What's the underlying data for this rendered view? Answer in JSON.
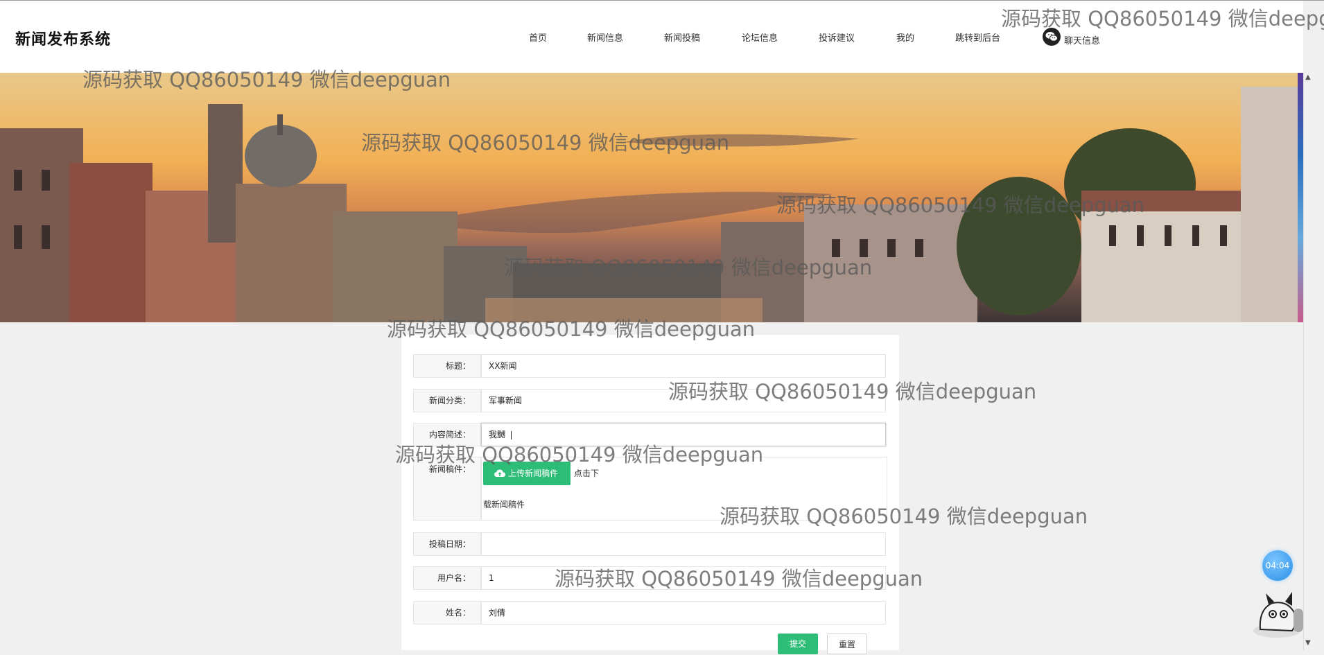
{
  "app": {
    "logo_text": "新闻发布系统"
  },
  "nav": {
    "items": [
      "首页",
      "新闻信息",
      "新闻投稿",
      "论坛信息",
      "投诉建议",
      "我的",
      "跳转到后台"
    ],
    "chat_label": "聊天信息"
  },
  "watermark_text": "源码获取 QQ86050149 微信deepguan",
  "form": {
    "fields": [
      {
        "label": "标题：",
        "value": "XX新闻"
      },
      {
        "label": "新闻分类：",
        "value": "军事新闻"
      },
      {
        "label": "内容简述：",
        "value": "我嬲"
      },
      {
        "label": "投稿日期：",
        "value": ""
      },
      {
        "label": "用户名：",
        "value": "1"
      },
      {
        "label": "姓名：",
        "value": "刘倩"
      }
    ],
    "upload": {
      "label": "新闻稿件：",
      "button_label": "上传新闻稿件",
      "note_part1": "点击下",
      "note_part2": "载新闻稿件"
    },
    "submit_label": "提交",
    "reset_label": "重置"
  },
  "timer": {
    "text": "04:04"
  },
  "colors": {
    "accent_green": "#2ebd77",
    "timer_blue": "#2a8fe6"
  }
}
